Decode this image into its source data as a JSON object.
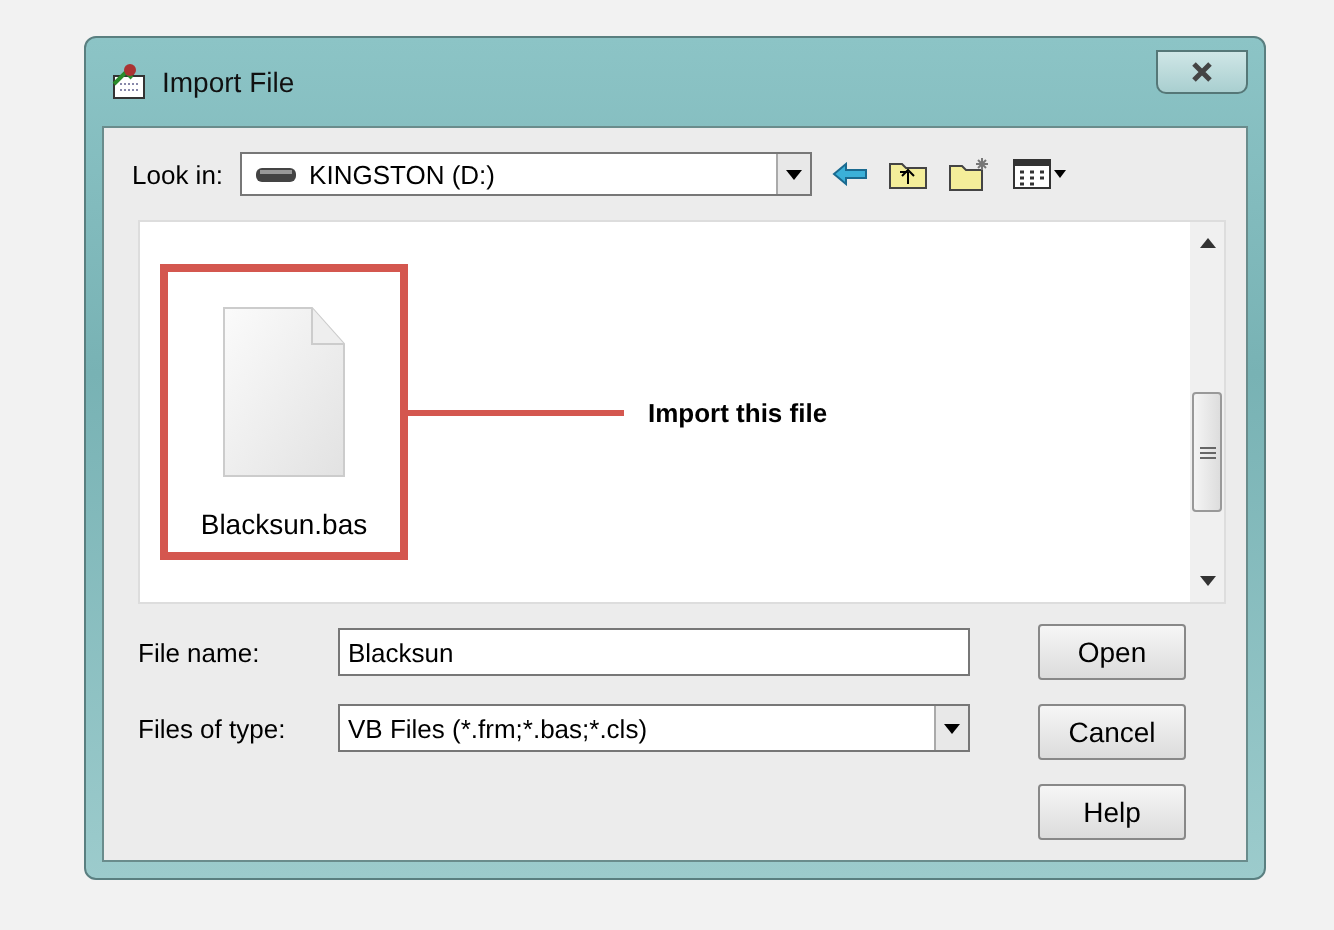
{
  "window": {
    "title": "Import File"
  },
  "look_in": {
    "label": "Look in:",
    "value": "KINGSTON (D:)"
  },
  "files": [
    {
      "name": "Blacksun.bas",
      "highlighted": true
    }
  ],
  "annotation": {
    "text": "Import this file"
  },
  "file_name": {
    "label": "File name:",
    "value": "Blacksun"
  },
  "file_type": {
    "label": "Files of type:",
    "value": "VB Files (*.frm;*.bas;*.cls)"
  },
  "buttons": [
    "Open",
    "Cancel",
    "Help"
  ]
}
